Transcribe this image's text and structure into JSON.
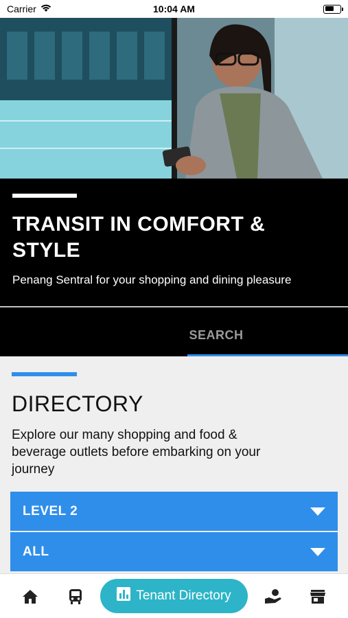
{
  "status_bar": {
    "carrier": "Carrier",
    "time": "10:04 AM",
    "battery_level": 0.6
  },
  "hero": {
    "image": "woman-with-phone-at-station"
  },
  "banner": {
    "title_line1": "TRANSIT IN COMFORT &",
    "title_line2": "STYLE",
    "subtitle": "Penang Sentral for your shopping and dining pleasure"
  },
  "tabs": {
    "search_label": "SEARCH"
  },
  "directory": {
    "title": "DIRECTORY",
    "description_line1": "Explore our many shopping and food &",
    "description_line2": "beverage outlets before embarking on your",
    "description_line3": "journey",
    "level_select": "LEVEL 2",
    "category_select": "ALL"
  },
  "bottom_nav": {
    "items": [
      {
        "icon": "home-icon"
      },
      {
        "icon": "bus-icon"
      },
      {
        "icon": "bar-chart-icon",
        "label": "Tenant Directory",
        "active": true
      },
      {
        "icon": "service-icon"
      },
      {
        "icon": "store-icon"
      }
    ]
  },
  "colors": {
    "accent": "#2f8eea",
    "active_pill": "#2db4c8",
    "banner_bg": "#000000"
  }
}
